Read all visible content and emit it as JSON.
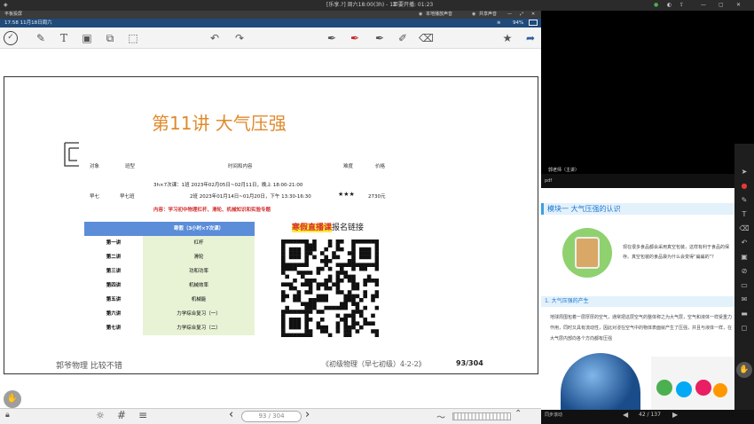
{
  "system_bar": {
    "title": "[乐享.?] 周六18:00(3h) - 11",
    "countdown": "距要开播: 01:23",
    "btn_local_audio": "本地播放声音",
    "btn_share_audio": "共享声音"
  },
  "app": {
    "name": "平板投屏",
    "status_time": "17:58 11月18日周六",
    "battery": "94%"
  },
  "doc": {
    "title": "第11讲 大气压强",
    "table_headers": [
      "对象",
      "班型",
      "时间和内容",
      "难度",
      "价格"
    ],
    "row_target": "早七",
    "row_class": "早七班",
    "time_lines": [
      "3h×7次课：1班 2023年02月05日~02月11日，晚上 18:00-21:00",
      "2班 2023年01月14日~01月20日，下午 13:30-16:30"
    ],
    "stars": "★★★",
    "price": "2730元",
    "content_line": "内容：学习初中物理杠杆、滑轮、机械知识和实验专题",
    "lessons_header": "寒假（3小时×7次课）",
    "lessons": [
      {
        "name": "第一讲",
        "topic": "杠杆"
      },
      {
        "name": "第二讲",
        "topic": "滑轮"
      },
      {
        "name": "第三讲",
        "topic": "功和功率"
      },
      {
        "name": "第四讲",
        "topic": "机械效率"
      },
      {
        "name": "第五讲",
        "topic": "机械能"
      },
      {
        "name": "第六讲",
        "topic": "力学综合复习（一）"
      },
      {
        "name": "第七讲",
        "topic": "力学综合复习（二）"
      }
    ],
    "live_label_highlight": "寒假直播课",
    "live_label_rest": "报名链接",
    "footer_left": "郭爷物理  比较不错",
    "footer_book": "《初级物理（早七初级）4-2-2》",
    "footer_page": "93/304"
  },
  "bottom": {
    "page_indicator": "93 / 304"
  },
  "right": {
    "presenter": "郭老师（主讲）",
    "section_label": "pdf",
    "module_title": "模块一  大气压强的认识",
    "slide_text_1": "现在很多食品都会采用真空包装，这样有利于食品的保存。真空包装的食品袋为什么会变得“扁扁的”？",
    "subsection": "1. 大气压强的产生",
    "slide_text_2": "地球周围包着一层厚厚的空气，通常把这层空气的整体称之为大气层，空气和液体一样受重力作用，同时又具有流动性，因此对浸在空气中的物体表面就产生了压强，并且与液体一样，在大气层内部向各个方向都有压强",
    "sync_label": "同步滚动",
    "page_indicator": "42 / 137"
  }
}
